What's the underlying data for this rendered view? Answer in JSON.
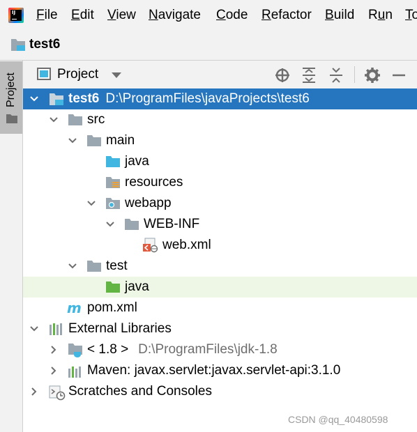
{
  "menu": [
    "File",
    "Edit",
    "View",
    "Navigate",
    "Code",
    "Refactor",
    "Build",
    "Run",
    "To"
  ],
  "menu_mnemonics": [
    "F",
    "E",
    "V",
    "N",
    "C",
    "R",
    "B",
    "u",
    "T"
  ],
  "app_logo_text": "IJ",
  "breadcrumb": {
    "project": "test6"
  },
  "stripe": {
    "label": "Project"
  },
  "toolwindow": {
    "title": "Project"
  },
  "tree": {
    "root": {
      "name": "test6",
      "path": "D:\\ProgramFiles\\javaProjects\\test6"
    },
    "src": "src",
    "main": "main",
    "java_main": "java",
    "resources": "resources",
    "webapp": "webapp",
    "webinf": "WEB-INF",
    "webxml": "web.xml",
    "test": "test",
    "java_test": "java",
    "pom": "pom.xml",
    "ext_libs": "External Libraries",
    "jdk": {
      "name": "< 1.8 >",
      "path": "D:\\ProgramFiles\\jdk-1.8"
    },
    "maven": "Maven: javax.servlet:javax.servlet-api:3.1.0",
    "scratches": "Scratches and Consoles"
  },
  "watermark": "CSDN @qq_40480598",
  "colors": {
    "selection": "#2675bf",
    "highlight_row": "#eef6e6",
    "folder_grey": "#9aa7b0",
    "folder_blue": "#40b6e0",
    "folder_green": "#62b543"
  }
}
